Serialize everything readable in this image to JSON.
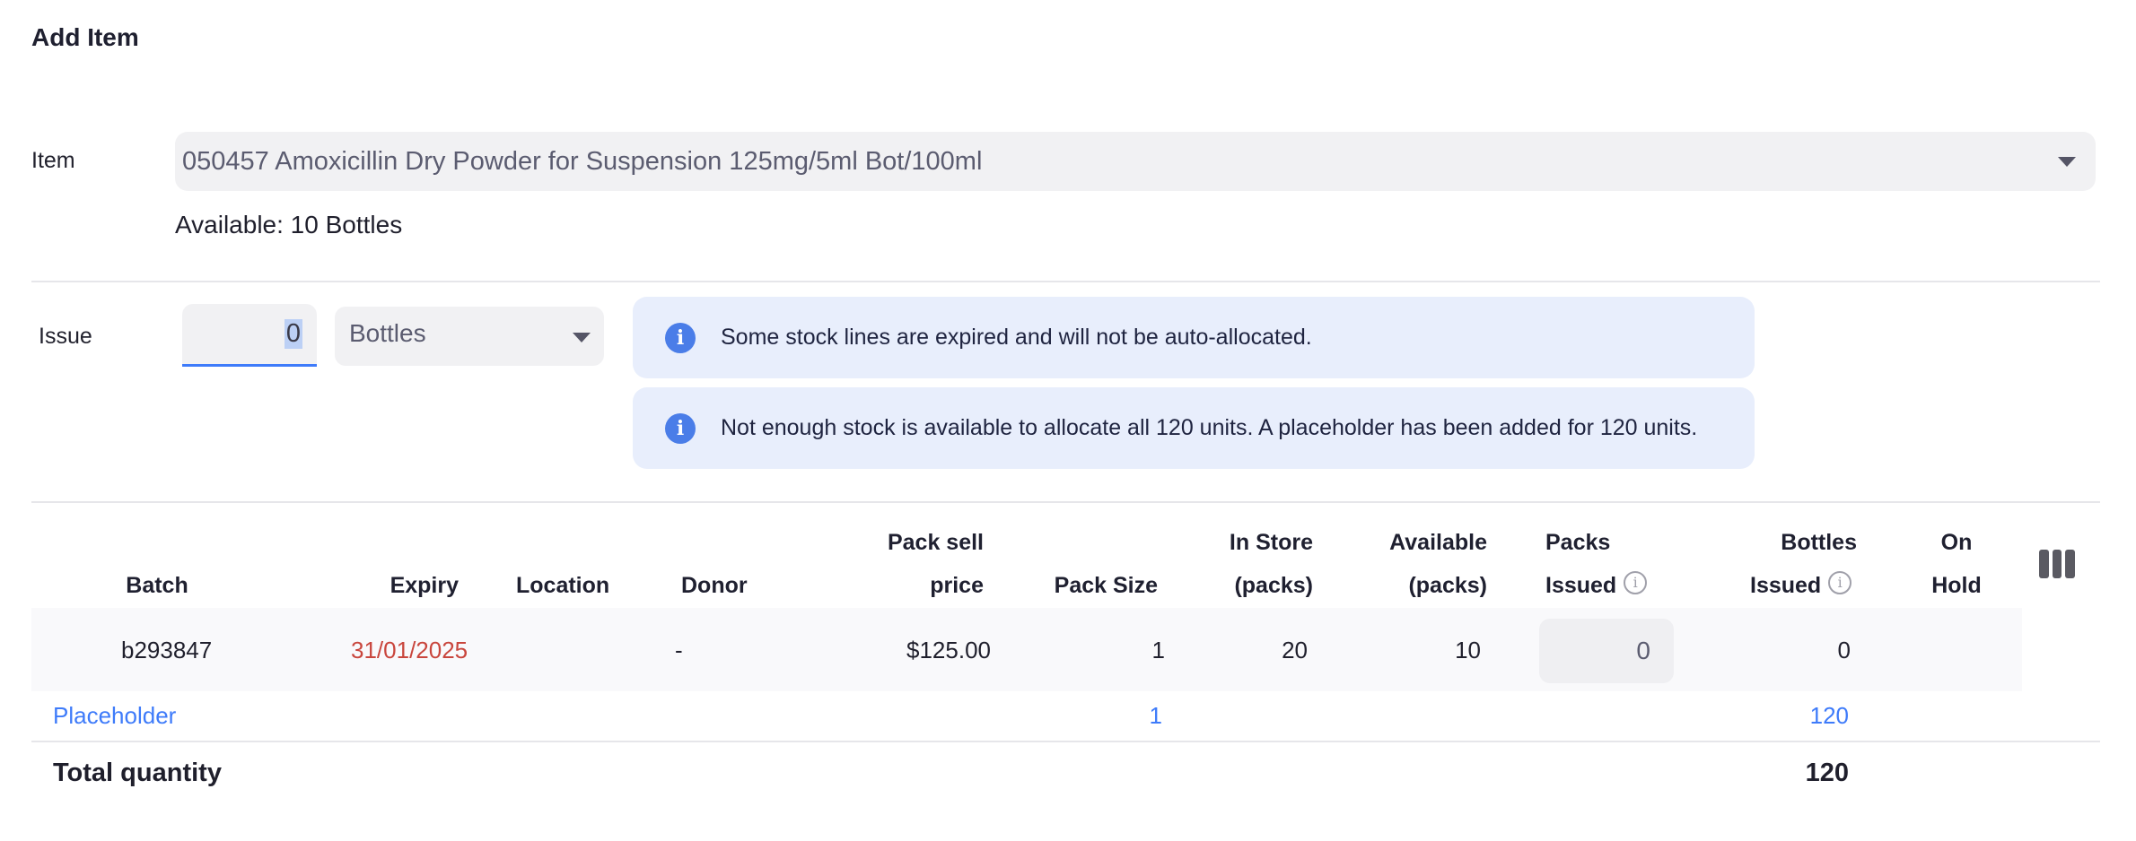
{
  "dialog": {
    "title": "Add Item"
  },
  "item": {
    "label": "Item",
    "selected": "050457 Amoxicillin Dry Powder for Suspension 125mg/5ml Bot/100ml",
    "available": "Available: 10 Bottles"
  },
  "issue": {
    "label": "Issue",
    "quantity": "0",
    "unit": "Bottles"
  },
  "alerts": [
    {
      "text": "Some stock lines are expired and will not be auto-allocated."
    },
    {
      "text": "Not enough stock is available to allocate all 120 units. A placeholder has been added for 120 units."
    }
  ],
  "table": {
    "headers": {
      "batch": "Batch",
      "expiry": "Expiry",
      "location": "Location",
      "donor": "Donor",
      "pack_sell_price_1": "Pack sell",
      "pack_sell_price_2": "price",
      "pack_size": "Pack Size",
      "in_store_1": "In Store",
      "in_store_2": "(packs)",
      "available_1": "Available",
      "available_2": "(packs)",
      "packs_issued_1": "Packs",
      "packs_issued_2": "Issued",
      "units_issued_1": "Bottles",
      "units_issued_2": "Issued",
      "on_hold_1": "On",
      "on_hold_2": "Hold"
    },
    "row": {
      "batch": "b293847",
      "expiry": "31/01/2025",
      "donor": "-",
      "pack_sell_price": "$125.00",
      "pack_size": "1",
      "in_store": "20",
      "available": "10",
      "packs_issued": "0",
      "units_issued": "0"
    },
    "placeholder": {
      "label": "Placeholder",
      "pack_size": "1",
      "units_issued": "120"
    },
    "total": {
      "label": "Total quantity",
      "value": "120"
    }
  },
  "colors": {
    "accent": "#3e7bfa",
    "expired": "#c9463d",
    "alert_bg": "#e8eefc"
  }
}
